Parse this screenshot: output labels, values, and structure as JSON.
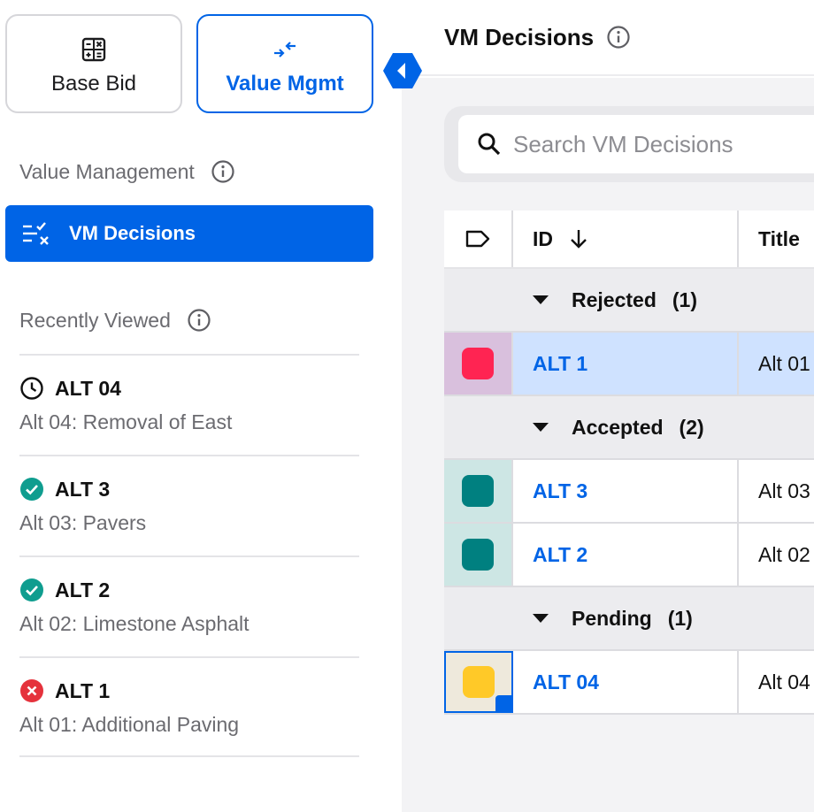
{
  "sidebar": {
    "modes": [
      {
        "label": "Base Bid",
        "icon": "calculator-icon",
        "active": false
      },
      {
        "label": "Value Mgmt",
        "icon": "arrows-converge-icon",
        "active": true
      }
    ],
    "section_value_management": "Value Management",
    "nav_active_label": "VM Decisions",
    "section_recently_viewed": "Recently Viewed",
    "recent": [
      {
        "id": "ALT 04",
        "subtitle": "Alt 04: Removal of East",
        "status": "pending",
        "icon": "clock-icon"
      },
      {
        "id": "ALT 3",
        "subtitle": "Alt 03: Pavers",
        "status": "accepted",
        "icon": "check-circle-icon"
      },
      {
        "id": "ALT 2",
        "subtitle": "Alt 02: Limestone Asphalt",
        "status": "accepted",
        "icon": "check-circle-icon"
      },
      {
        "id": "ALT 1",
        "subtitle": "Alt 01: Additional Paving",
        "status": "rejected",
        "icon": "x-circle-icon"
      }
    ]
  },
  "main": {
    "title": "VM Decisions",
    "search_placeholder": "Search VM Decisions",
    "columns": {
      "id": "ID",
      "title": "Title"
    },
    "groups": [
      {
        "label": "Rejected",
        "count": "(1)",
        "rows": [
          {
            "id": "ALT 1",
            "title": "Alt 01",
            "color": "#ff2452",
            "tint": "#d9c0dd",
            "selected": true
          }
        ]
      },
      {
        "label": "Accepted",
        "count": "(2)",
        "rows": [
          {
            "id": "ALT 3",
            "title": "Alt 03",
            "color": "#008080",
            "tint": "#cde6e4",
            "selected": false
          },
          {
            "id": "ALT 2",
            "title": "Alt 02",
            "color": "#008080",
            "tint": "#cde6e4",
            "selected": false
          }
        ]
      },
      {
        "label": "Pending",
        "count": "(1)",
        "rows": [
          {
            "id": "ALT 04",
            "title": "Alt 04",
            "color": "#ffc928",
            "tint": "#eee9dc",
            "selected": false,
            "focused": true
          }
        ]
      }
    ]
  },
  "colors": {
    "accent": "#0064e6",
    "accepted": "#0f9d8f",
    "rejected": "#e5323c"
  }
}
